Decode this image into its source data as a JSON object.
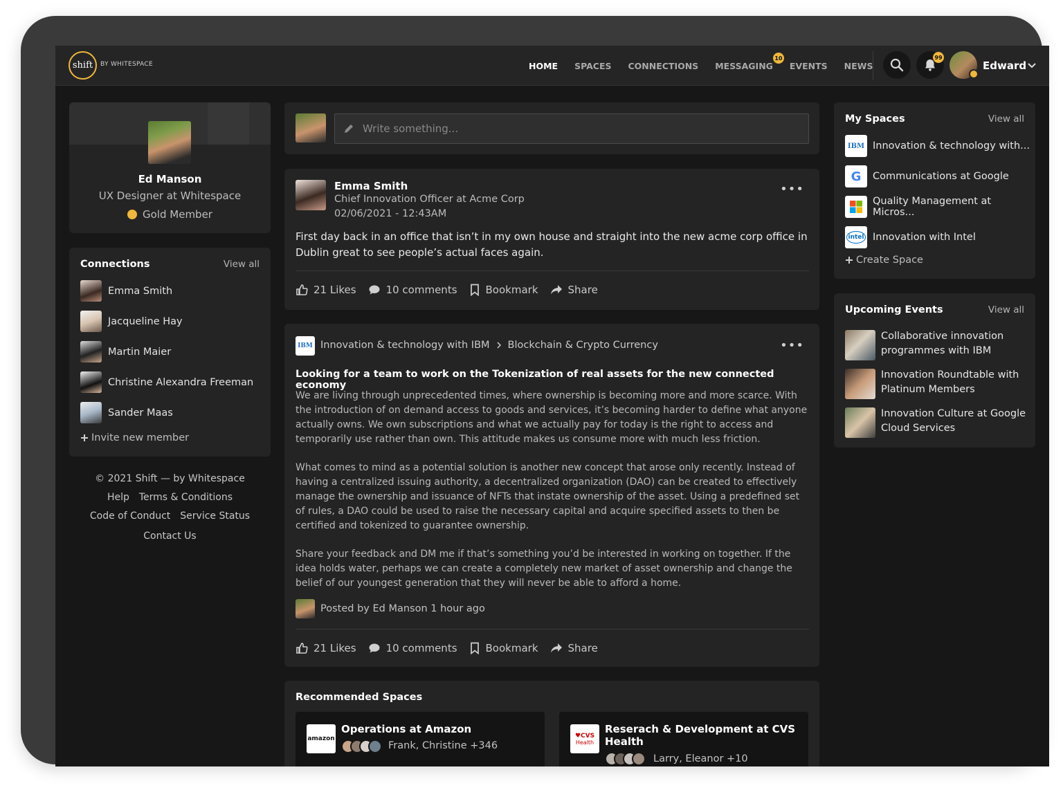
{
  "app": {
    "logo_text": "shift",
    "logo_sub": "BY WHITESPACE"
  },
  "nav": {
    "items": [
      "HOME",
      "SPACES",
      "CONNECTIONS",
      "MESSAGING",
      "EVENTS",
      "NEWS"
    ],
    "messaging_badge": "10",
    "notifications_badge": "99",
    "user_name": "Edward"
  },
  "profile": {
    "name": "Ed Manson",
    "role": "UX Designer at Whitespace",
    "membership": "Gold Member"
  },
  "connections": {
    "title": "Connections",
    "view_all": "View all",
    "items": [
      "Emma Smith",
      "Jacqueline Hay",
      "Martin Maier",
      "Christine Alexandra Freeman",
      "Sander Maas"
    ],
    "invite": "Invite new member"
  },
  "footer": {
    "copyright": "© 2021 Shift — by Whitespace",
    "help": "Help",
    "terms": "Terms & Conditions",
    "code": "Code of Conduct",
    "status": "Service Status",
    "contact": "Contact Us"
  },
  "composer": {
    "placeholder": "Write something..."
  },
  "post1": {
    "author": "Emma Smith",
    "title": "Chief Innovation Officer at Acme Corp",
    "date": "02/06/2021 - 12:43AM",
    "text": "First day back in an office that isn’t in my own house and straight into the new acme corp office in Dublin great to see people’s actual faces again.",
    "likes": "21 Likes",
    "comments": "10 comments",
    "bookmark": "Bookmark",
    "share": "Share"
  },
  "post2": {
    "space": "Innovation & technology with IBM",
    "topic": "Blockchain & Crypto Currency",
    "space_logo": "IBM",
    "title": "Looking for a team to work on the Tokenization of real assets for the new connected economy",
    "p1": "We are living through unprecedented times, where ownership is becoming more and more scarce. With the introduction of on demand access to goods and services, it’s becoming harder to define what anyone actually owns. We own subscriptions and what we actually pay for today is the right to access and temporarily use rather than own. This attitude makes us consume more with much less friction.",
    "p2": "What comes to mind as a potential solution is another new concept that arose only recently. Instead of having a centralized issuing authority, a decentralized organization (DAO) can be created to effectively manage the ownership and issuance of NFTs that instate ownership of the asset. Using a predefined set of rules, a DAO could be used to raise the necessary capital and acquire specified assets to then be certified and tokenized to guarantee ownership.",
    "p3": "Share your feedback and DM me if that’s something you’d be interested in working on together. If the idea holds water, perhaps we can create a completely new market of asset ownership and change the belief of our youngest generation that they will never be able to afford a home.",
    "posted_by": "Posted by Ed Manson 1 hour ago",
    "likes": "21 Likes",
    "comments": "10 comments",
    "bookmark": "Bookmark",
    "share": "Share"
  },
  "recommended": {
    "title": "Recommended Spaces",
    "items": [
      {
        "name": "Operations at Amazon",
        "members": "Frank, Christine +346",
        "logo": "amazon"
      },
      {
        "name": "Reserach & Development  at CVS Health",
        "members": "Larry, Eleanor +10",
        "logo_top": "♥CVS",
        "logo_bottom": "Health"
      }
    ]
  },
  "my_spaces": {
    "title": "My Spaces",
    "view_all": "View all",
    "items": [
      "Innovation & technology with...",
      "Communications at Google",
      "Quality Management at Micros...",
      "Innovation with Intel"
    ],
    "logos": [
      "IBM",
      "G",
      "",
      "intel"
    ],
    "create": "Create Space"
  },
  "events": {
    "title": "Upcoming Events",
    "view_all": "View all",
    "items": [
      "Collaborative innovation programmes with IBM",
      "Innovation Roundtable with Platinum Members",
      "Innovation Culture at Google Cloud Services"
    ]
  },
  "colors": {
    "accent": "#f0b73a",
    "bg": "#171717",
    "card": "#242424",
    "topbar": "#252525"
  }
}
